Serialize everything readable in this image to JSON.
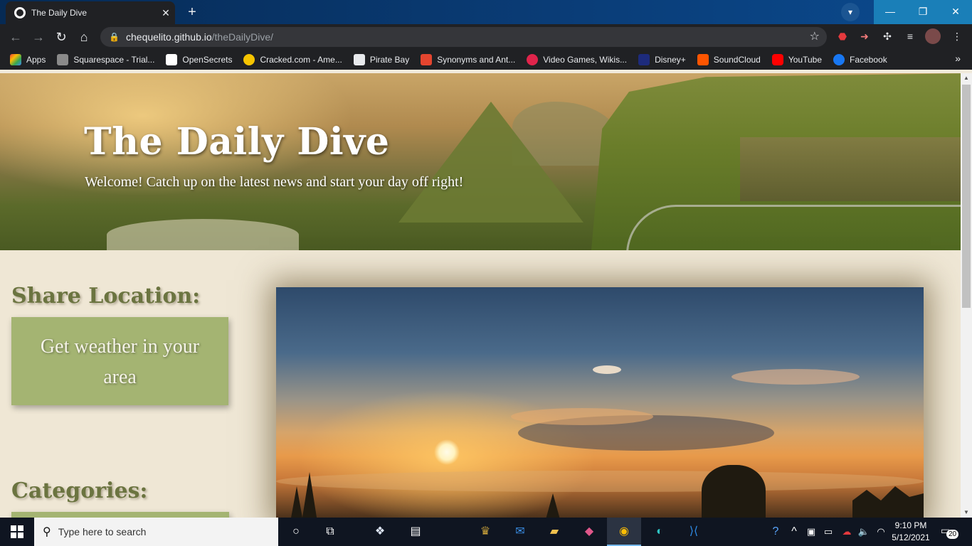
{
  "browser": {
    "tab_title": "The Daily Dive",
    "tab_close": "✕",
    "new_tab": "+",
    "url_host": "chequelito.github.io",
    "url_path": "/theDailyDive/",
    "bookmarks": [
      {
        "label": "Apps",
        "color": "#ea4335"
      },
      {
        "label": "Squarespace - Trial...",
        "color": "#8a8a8a"
      },
      {
        "label": "OpenSecrets",
        "color": "#ffffff"
      },
      {
        "label": "Cracked.com - Ame...",
        "color": "#f6c400"
      },
      {
        "label": "Pirate Bay",
        "color": "#e8eaed"
      },
      {
        "label": "Synonyms and Ant...",
        "color": "#e4452f"
      },
      {
        "label": "Video Games, Wikis...",
        "color": "#e0244b"
      },
      {
        "label": "Disney+",
        "color": "#1d2b7c"
      },
      {
        "label": "SoundCloud",
        "color": "#ff5500"
      },
      {
        "label": "YouTube",
        "color": "#ff0000"
      },
      {
        "label": "Facebook",
        "color": "#1877f2"
      }
    ],
    "bookmarks_more": "»"
  },
  "page": {
    "hero_title": "The Daily Dive",
    "hero_subtitle": "Welcome! Catch up on the latest news and start your day off right!",
    "share_heading": "Share Location:",
    "weather_button": "Get weather in your area",
    "categories_heading": "Categories:"
  },
  "taskbar": {
    "search_placeholder": "Type here to search",
    "time": "9:10 PM",
    "date": "5/12/2021",
    "notifications": "20"
  },
  "colors": {
    "accent_green": "#a4b472",
    "heading_olive": "#6b7440",
    "page_bg": "#efe7d5"
  }
}
